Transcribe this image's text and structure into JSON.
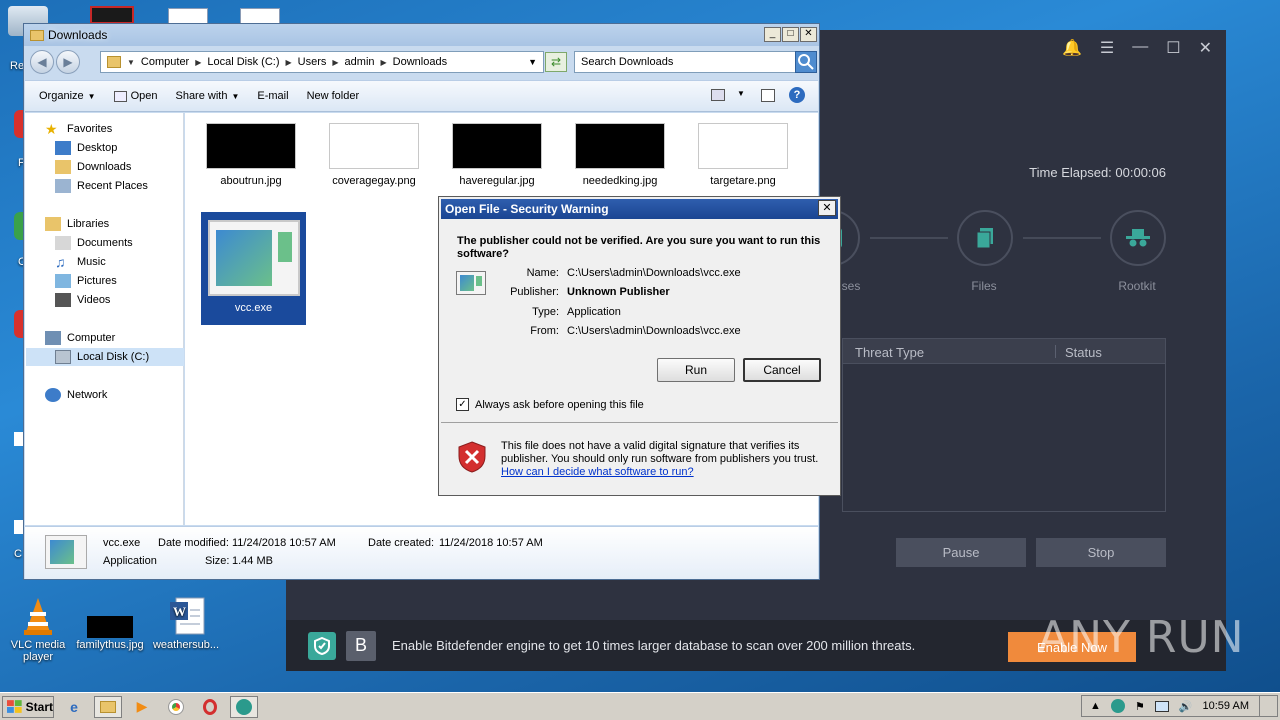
{
  "desktop": {
    "icons": [
      {
        "label": "VLC media player"
      },
      {
        "label": "familythus.jpg"
      },
      {
        "label": "weathersub..."
      }
    ],
    "left_fragments": [
      "Re",
      "F",
      "C",
      "C"
    ]
  },
  "scanner": {
    "time_elapsed": "Time Elapsed: 00:00:06",
    "stages": [
      "ses",
      "Files",
      "Rootkit"
    ],
    "table_headers": [
      "Threat Type",
      "Status"
    ],
    "pause_label": "Pause",
    "stop_label": "Stop",
    "banner_text": "Enable Bitdefender engine to get 10 times larger database to scan over 200 million threats.",
    "enable_label": "Enable Now",
    "watermark": "ANY RUN"
  },
  "explorer": {
    "title": "Downloads",
    "breadcrumbs": [
      "Computer",
      "Local Disk (C:)",
      "Users",
      "admin",
      "Downloads"
    ],
    "search_placeholder": "Search Downloads",
    "toolbar": [
      "Organize",
      "Open",
      "Share with",
      "E-mail",
      "New folder"
    ],
    "nav": {
      "favorites": "Favorites",
      "desktop": "Desktop",
      "downloads": "Downloads",
      "recent": "Recent Places",
      "libraries": "Libraries",
      "documents": "Documents",
      "music": "Music",
      "pictures": "Pictures",
      "videos": "Videos",
      "computer": "Computer",
      "localdisk": "Local Disk (C:)",
      "network": "Network"
    },
    "files": [
      {
        "name": "aboutrun.jpg",
        "thumb": "#000000"
      },
      {
        "name": "coveragegay.png",
        "thumb": "#ffffff"
      },
      {
        "name": "haveregular.jpg",
        "thumb": "#000000"
      },
      {
        "name": "neededking.jpg",
        "thumb": "#000000"
      },
      {
        "name": "targetare.png",
        "thumb": "#ffffff"
      },
      {
        "name": "vcc.exe",
        "thumb": "#5aa88a"
      }
    ],
    "details": {
      "name": "vcc.exe",
      "type": "Application",
      "modified_label": "Date modified:",
      "modified": "11/24/2018 10:57 AM",
      "created_label": "Date created:",
      "created": "11/24/2018 10:57 AM",
      "size_label": "Size:",
      "size": "1.44 MB"
    }
  },
  "dialog": {
    "title": "Open File - Security Warning",
    "question": "The publisher could not be verified.  Are you sure you want to run this software?",
    "name_label": "Name:",
    "name": "C:\\Users\\admin\\Downloads\\vcc.exe",
    "publisher_label": "Publisher:",
    "publisher": "Unknown Publisher",
    "type_label": "Type:",
    "type": "Application",
    "from_label": "From:",
    "from": "C:\\Users\\admin\\Downloads\\vcc.exe",
    "run_label": "Run",
    "cancel_label": "Cancel",
    "checkbox_label": "Always ask before opening this file",
    "checkbox_checked": true,
    "warning_text": "This file does not have a valid digital signature that verifies its publisher.  You should only run software from publishers you trust.",
    "help_link": "How can I decide what software to run?"
  },
  "taskbar": {
    "start_label": "Start",
    "clock": "10:59 AM"
  },
  "colors": {
    "scanner_bg": "#2e3240",
    "accent_teal": "#3aa89a",
    "enable_orange": "#f08a3c"
  }
}
